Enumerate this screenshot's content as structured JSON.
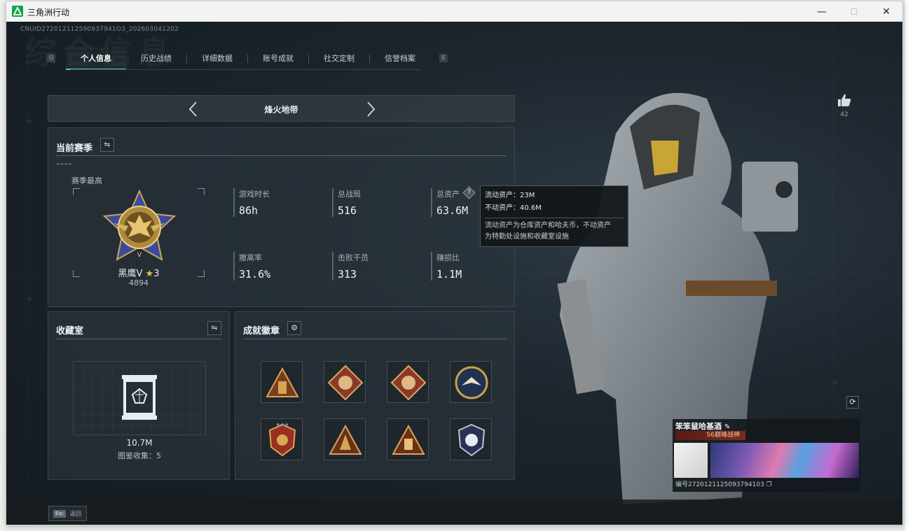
{
  "window": {
    "title": "三角洲行动",
    "minimize": "—",
    "maximize": "☐",
    "close": "✕"
  },
  "header": {
    "uid_text": "CNUID272012112590937941O3_202603041202",
    "bg_title": "综合信息"
  },
  "tabs": {
    "key_left": "Q",
    "key_right": "E",
    "items": [
      "个人信息",
      "历史战绩",
      "详细数据",
      "账号成就",
      "社交定制",
      "信誉档案"
    ],
    "active_index": 0
  },
  "mode": {
    "title": "烽火地带"
  },
  "season": {
    "title": "当前赛季",
    "season_high_label": "赛季最高",
    "rank_name": "黑鹰V",
    "rank_stars": "3",
    "rank_score": "4894",
    "stats": [
      {
        "label": "游戏时长",
        "value": "86h"
      },
      {
        "label": "总战局",
        "value": "516"
      },
      {
        "label": "总资产",
        "value": "63.6M"
      },
      {
        "label": "撤离率",
        "value": "31.6%"
      },
      {
        "label": "击败干员",
        "value": "313"
      },
      {
        "label": "赚损比",
        "value": "1.1M"
      }
    ]
  },
  "tooltip": {
    "liquid": "流动资产：23M",
    "fixed": "不动资产：40.6M",
    "desc1": "流动资产为仓库资产和哈夫币，不动资产",
    "desc2": "为特勤处设施和收藏室设施"
  },
  "collection": {
    "title": "收藏室",
    "value": "10.7M",
    "count_label": "图鉴收集：5"
  },
  "achievements": {
    "title": "成就徽章",
    "badges": [
      "pyramid-badge-icon",
      "dragon-badge-icon",
      "dragon-badge-icon",
      "eagle-badge-icon",
      "shield-badge-icon",
      "triangle-badge-icon",
      "hand-triangle-badge-icon",
      "wolf-badge-icon"
    ]
  },
  "social": {
    "like_count": "42"
  },
  "card": {
    "name": "笨笨鼠哈基酒",
    "title": "S6巅峰战神",
    "id_text": "编号2720121125093794103"
  },
  "bottom": {
    "esc_key": "Esc",
    "esc_label": "返回"
  },
  "colors": {
    "accent": "#5fc3a0",
    "background": "#1c242c",
    "app_icon": "#10a64a"
  }
}
